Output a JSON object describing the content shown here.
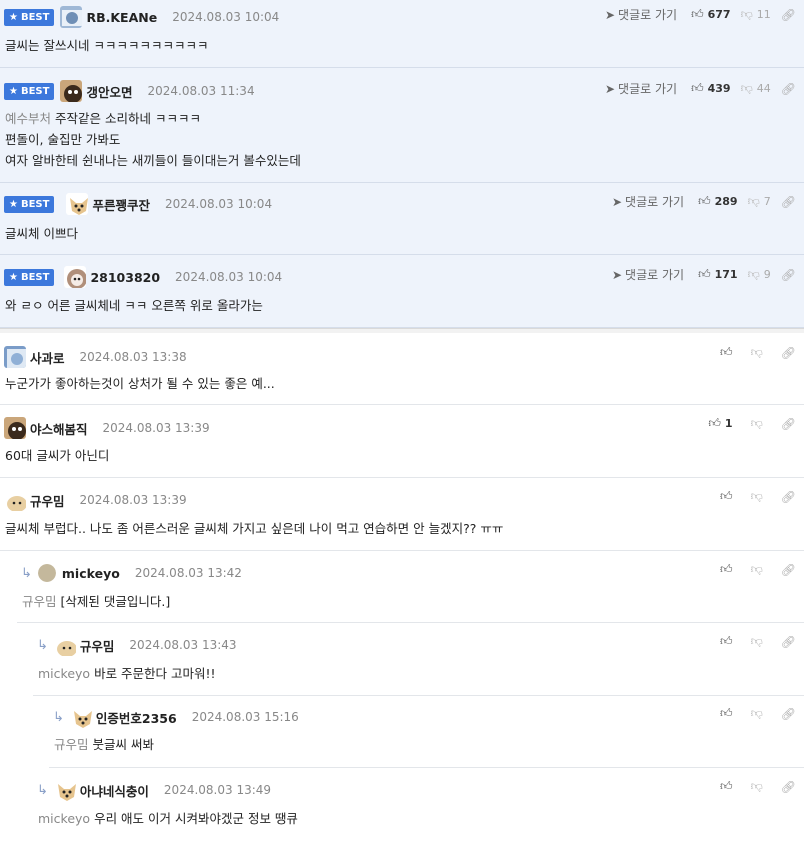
{
  "labels": {
    "best": "BEST",
    "goto": "댓글로 가기"
  },
  "best_comments": [
    {
      "nick": "RB.KEANe",
      "date": "2024.08.03 10:04",
      "lines": [
        "글씨는 잘쓰시네 ㅋㅋㅋㅋㅋㅋㅋㅋㅋㅋ"
      ],
      "up": "677",
      "down": "11",
      "mention": ""
    },
    {
      "nick": "갱안오면",
      "date": "2024.08.03 11:34",
      "mention": "예수부처",
      "lines": [
        "주작같은 소리하네 ㅋㅋㅋㅋ",
        "편돌이, 술집만 가봐도",
        "여자 알바한테 쉰내나는 새끼들이 들이대는거 볼수있는데"
      ],
      "up": "439",
      "down": "44"
    },
    {
      "nick": "푸른꽹쿠잔",
      "date": "2024.08.03 10:04",
      "lines": [
        "글씨체 이쁘다"
      ],
      "up": "289",
      "down": "7",
      "mention": ""
    },
    {
      "nick": "28103820",
      "date": "2024.08.03 10:04",
      "lines": [
        "와 ㄹㅇ 어른 글씨체네 ㅋㅋ 오른쪽 위로 올라가는"
      ],
      "up": "171",
      "down": "9",
      "mention": ""
    }
  ],
  "comments": [
    {
      "nick": "사과로",
      "date": "2024.08.03 13:38",
      "mention": "",
      "text": "누군가가 좋아하는것이 상처가 될 수 있는 좋은 예...",
      "up": ""
    },
    {
      "nick": "야스해봄직",
      "date": "2024.08.03 13:39",
      "mention": "",
      "text": "60대 글씨가 아닌디",
      "up": "1"
    },
    {
      "nick": "규우밈",
      "date": "2024.08.03 13:39",
      "mention": "",
      "text": "글씨체 부럽다.. 나도 좀 어른스러운 글씨체 가지고 싶은데 나이 먹고 연습하면 안 늘겠지?? ㅠㅠ",
      "up": ""
    },
    {
      "nick": "mickeyo",
      "date": "2024.08.03 13:42",
      "mention": "규우밈",
      "text": "[삭제된 댓글입니다.]",
      "up": ""
    },
    {
      "nick": "규우밈",
      "date": "2024.08.03 13:43",
      "mention": "mickeyo",
      "text": "바로 주문한다 고마워!!",
      "up": ""
    },
    {
      "nick": "인증번호2356",
      "date": "2024.08.03 15:16",
      "mention": "규우밈",
      "text": "붓글씨 써봐",
      "up": ""
    },
    {
      "nick": "아냐네식충이",
      "date": "2024.08.03 13:49",
      "mention": "mickeyo",
      "text": "우리 애도 이거 시켜봐야겠군 정보 땡큐",
      "up": ""
    }
  ]
}
